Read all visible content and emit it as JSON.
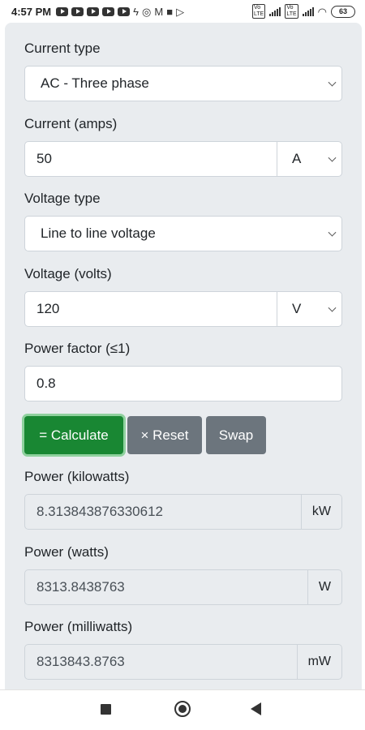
{
  "status_bar": {
    "time": "4:57 PM",
    "battery": "63",
    "left_icons": [
      "youtube-icon",
      "youtube-icon",
      "youtube-icon",
      "youtube-icon",
      "youtube-icon",
      "zap-icon",
      "instagram-icon",
      "gmail-icon",
      "puzzle-icon",
      "play-store-icon"
    ]
  },
  "form": {
    "current_type": {
      "label": "Current type",
      "selected": "AC - Three phase"
    },
    "current": {
      "label": "Current (amps)",
      "value": "50",
      "unit": "A"
    },
    "voltage_type": {
      "label": "Voltage type",
      "selected": "Line to line voltage"
    },
    "voltage": {
      "label": "Voltage (volts)",
      "value": "120",
      "unit": "V"
    },
    "power_factor": {
      "label": "Power factor (≤1)",
      "value": "0.8"
    }
  },
  "buttons": {
    "calculate": "= Calculate",
    "reset": "× Reset",
    "swap": "Swap"
  },
  "results": {
    "kilowatts": {
      "label": "Power (kilowatts)",
      "value": "8.313843876330612",
      "unit": "kW"
    },
    "watts": {
      "label": "Power (watts)",
      "value": "8313.8438763",
      "unit": "W"
    },
    "milliwatts": {
      "label": "Power (milliwatts)",
      "value": "8313843.8763",
      "unit": "mW"
    }
  },
  "colors": {
    "calculate_button": "#198733",
    "secondary_button": "#6c757d",
    "card_background": "#e9ecef"
  }
}
